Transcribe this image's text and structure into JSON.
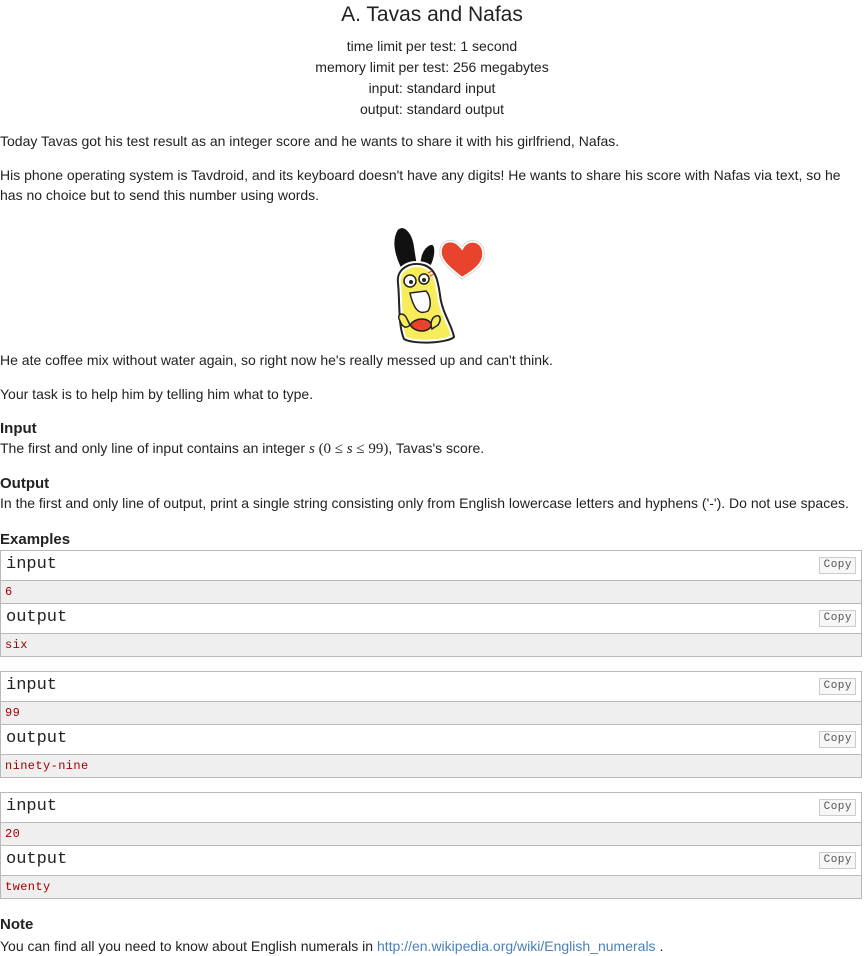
{
  "problem": {
    "title": "A. Tavas and Nafas",
    "limits": [
      "time limit per test: 1 second",
      "memory limit per test: 256 megabytes",
      "input: standard input",
      "output: standard output"
    ],
    "statement": [
      "Today Tavas got his test result as an integer score and he wants to share it with his girlfriend, Nafas.",
      "His phone operating system is Tavdroid, and its keyboard doesn't have any digits! He wants to share his score with Nafas via text, so he has no choice but to send this number using words."
    ],
    "statement_after": [
      "He ate coffee mix without water again, so right now he's really messed up and can't think.",
      "Your task is to help him by telling him what to type."
    ]
  },
  "input_section": {
    "title": "Input",
    "text_before": "The first and only line of input contains an integer ",
    "var": "s",
    "constraint_open": " (0 ≤ ",
    "constraint_var": "s",
    "constraint_close": " ≤ 99)",
    "text_after": ", Tavas's score."
  },
  "output_section": {
    "title": "Output",
    "text": "In the first and only line of output, print a single string consisting only from English lowercase letters and hyphens ('-'). Do not use spaces."
  },
  "examples": {
    "title": "Examples",
    "copy_label": "Copy",
    "input_label": "input",
    "output_label": "output",
    "items": [
      {
        "input": "6",
        "output": "six"
      },
      {
        "input": "99",
        "output": "ninety-nine"
      },
      {
        "input": "20",
        "output": "twenty"
      }
    ]
  },
  "note": {
    "title": "Note",
    "text": "You can find all you need to know about English numerals in ",
    "link_text": "http://en.wikipedia.org/wiki/English_numerals",
    "after": " ."
  },
  "colors": {
    "accent_link": "#4a80b8",
    "sample_text": "#a00000",
    "heart": "#e8432c",
    "character": "#f7ec5a"
  }
}
